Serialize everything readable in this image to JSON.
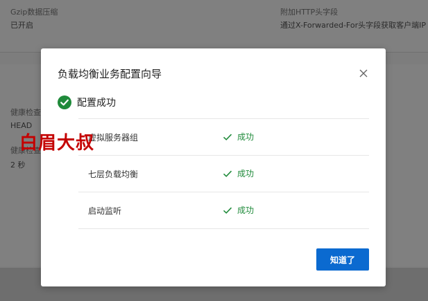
{
  "background": {
    "gzip_label": "Gzip数据压缩",
    "gzip_value": "已开启",
    "http_header_label": "附加HTTP头字段",
    "http_header_value": "通过X-Forwarded-For头字段获取客户端IP",
    "health_check_method_label": "健康检查",
    "health_check_method_value": "HEAD",
    "health_check_interval_label": "健康检查",
    "health_check_interval_value": "2 秒"
  },
  "watermark": "白眉大叔",
  "modal": {
    "title": "负载均衡业务配置向导",
    "result_text": "配置成功",
    "steps": [
      {
        "name": "虚拟服务器组",
        "status": "成功"
      },
      {
        "name": "七层负载均衡",
        "status": "成功"
      },
      {
        "name": "启动监听",
        "status": "成功"
      }
    ],
    "confirm_label": "知道了"
  },
  "colors": {
    "success": "#1f8a3a",
    "primary": "#0b6ad0",
    "overlay": "#7d7d7d"
  }
}
